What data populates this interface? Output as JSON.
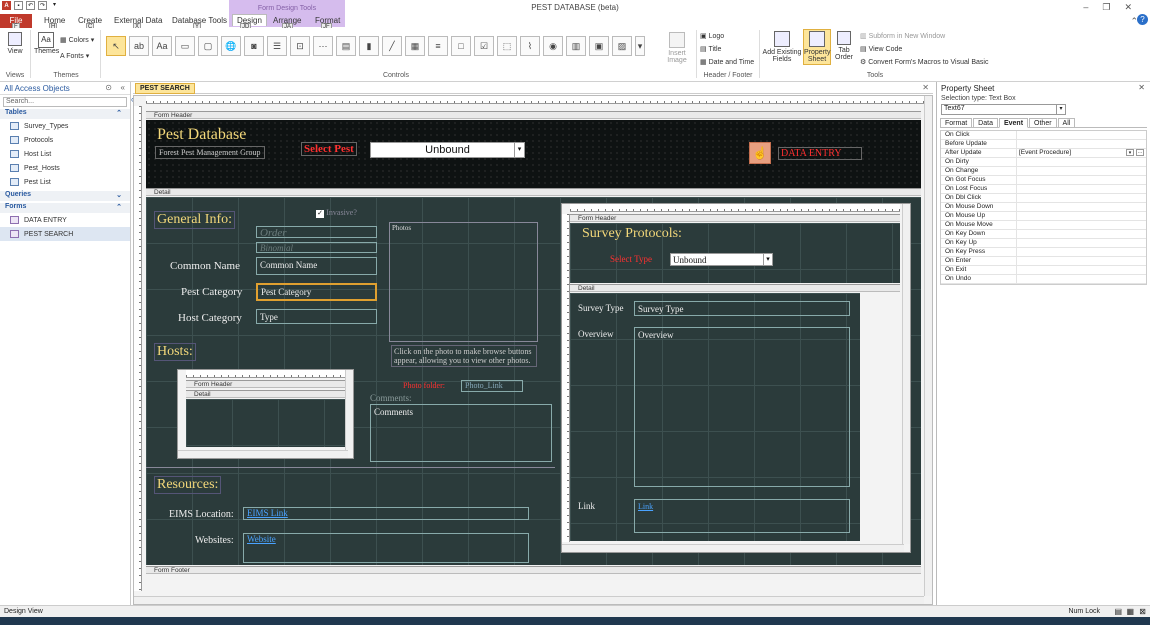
{
  "window": {
    "title": "PEST DATABASE (beta)"
  },
  "contextual_tab": {
    "label": "Form Design Tools"
  },
  "ribbon_tabs": [
    "File",
    "Home",
    "Create",
    "External Data",
    "Database Tools",
    "Design",
    "Arrange",
    "Format"
  ],
  "keytips": [
    "F",
    "H",
    "C",
    "X",
    "Y",
    "JD",
    "JA",
    "JF"
  ],
  "ribbon": {
    "views": {
      "view_label": "View",
      "group": "Views"
    },
    "themes": {
      "themes_label": "Themes",
      "colors_label": "Colors",
      "fonts_label": "Fonts",
      "group": "Themes"
    },
    "controls_group": "Controls",
    "insert_image": "Insert Image",
    "header_footer": {
      "logo": "Logo",
      "title": "Title",
      "date_time": "Date and Time",
      "group": "Header / Footer"
    },
    "tools": {
      "add_existing_fields": "Add Existing Fields",
      "property_sheet": "Property Sheet",
      "tab_order": "Tab Order",
      "subform_new_window": "Subform in New Window",
      "view_code": "View Code",
      "convert_macros": "Convert Form's Macros to Visual Basic",
      "group": "Tools"
    }
  },
  "nav_pane": {
    "title": "All Access Objects",
    "search_placeholder": "Search...",
    "groups": [
      {
        "name": "Tables",
        "items": [
          "Survey_Types",
          "Protocols",
          "Host List",
          "Pest_Hosts",
          "Pest List"
        ]
      },
      {
        "name": "Queries",
        "items": []
      },
      {
        "name": "Forms",
        "items": [
          "DATA ENTRY",
          "PEST SEARCH"
        ]
      }
    ]
  },
  "document_tab": "PEST SEARCH",
  "form": {
    "sections": {
      "header": "Form Header",
      "detail": "Detail",
      "footer": "Form Footer"
    },
    "header": {
      "title": "Pest Database",
      "subtitle": "Forest Pest Management Group",
      "select_pest_label": "Select Pest",
      "select_pest_value": "Unbound",
      "data_entry_label": "DATA ENTRY"
    },
    "detail": {
      "general_info": "General Info:",
      "invasive_label": "Invasive?",
      "order_placeholder": "Order",
      "binomial_placeholder": "Binomial",
      "common_name_label": "Common Name",
      "common_name_value": "Common Name",
      "pest_category_label": "Pest Category",
      "pest_category_value": "Pest Category",
      "host_category_label": "Host Category",
      "host_category_value": "Type",
      "photos_label": "Photos",
      "photo_hint": "Click on the photo to make browse buttons appear, allowing you to view other photos.",
      "photo_folder_label": "Photo folder:",
      "photo_link_value": "Photo_Link",
      "hosts_label": "Hosts:",
      "subform_header": "Form Header",
      "subform_detail": "Detail",
      "comments_label": "Comments:",
      "comments_value": "Comments",
      "resources_label": "Resources:",
      "eims_label": "EIMS Location:",
      "eims_value": "EIMS Link",
      "websites_label": "Websites:",
      "websites_value": "Website"
    },
    "survey_subform": {
      "header": "Form Header",
      "detail": "Detail",
      "title": "Survey Protocols:",
      "select_type_label": "Select Type",
      "select_type_value": "Unbound",
      "survey_type_label": "Survey Type",
      "survey_type_value": "Survey Type",
      "overview_label": "Overview",
      "overview_value": "Overview",
      "link_label": "Link",
      "link_value": "Link"
    }
  },
  "property_sheet": {
    "title": "Property Sheet",
    "selection_type": "Selection type:  Text Box",
    "selected_object": "Text67",
    "tabs": [
      "Format",
      "Data",
      "Event",
      "Other",
      "All"
    ],
    "active_tab": "Event",
    "rows": [
      {
        "k": "On Click",
        "v": ""
      },
      {
        "k": "Before Update",
        "v": ""
      },
      {
        "k": "After Update",
        "v": "[Event Procedure]"
      },
      {
        "k": "On Dirty",
        "v": ""
      },
      {
        "k": "On Change",
        "v": ""
      },
      {
        "k": "On Got Focus",
        "v": ""
      },
      {
        "k": "On Lost Focus",
        "v": ""
      },
      {
        "k": "On Dbl Click",
        "v": ""
      },
      {
        "k": "On Mouse Down",
        "v": ""
      },
      {
        "k": "On Mouse Up",
        "v": ""
      },
      {
        "k": "On Mouse Move",
        "v": ""
      },
      {
        "k": "On Key Down",
        "v": ""
      },
      {
        "k": "On Key Up",
        "v": ""
      },
      {
        "k": "On Key Press",
        "v": ""
      },
      {
        "k": "On Enter",
        "v": ""
      },
      {
        "k": "On Exit",
        "v": ""
      },
      {
        "k": "On Undo",
        "v": ""
      }
    ]
  },
  "status": {
    "left": "Design View",
    "right": "Num Lock"
  }
}
